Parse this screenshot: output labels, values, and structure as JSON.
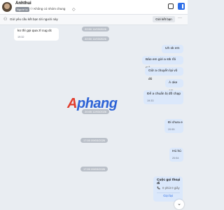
{
  "header": {
    "contact_name": "Anhthui",
    "badge": "Người lạ",
    "group_status": "Không có nhóm chung",
    "tag_icon": "tag-icon",
    "icons": [
      "window-icon",
      "sidebar-toggle-icon"
    ]
  },
  "request_bar": {
    "text": "Gửi yêu cầu kết bạn tới người này",
    "button": "Gửi kết bạn",
    "more": "···"
  },
  "timestamps": {
    "t1": "22:50 11/03/2026",
    "t2": "22:50 11/03/2026",
    "t3": "20:55 12/03/2026",
    "t4": "17:00 09/03/2026"
  },
  "messages": {
    "m1_text": "ko thì gọi qua zl cug dc",
    "m1_time": "19:32",
    "m2_text": "Uh ok em",
    "m3_text": "Bảo em gửi a stk rồi mà",
    "m4_text": "Giờ a chuyển lại vô đó",
    "m5_text": "À oke em",
    "m6_text": "Để a chuẩn bị đồ chạp",
    "m6_time": "19:33",
    "m7_text": "Đi chưa e",
    "m7_time": "20:55",
    "m8_text": "Hú hú",
    "m8_time": "20:54"
  },
  "call": {
    "title": "Cuộc gọi thoại đi",
    "duration": "0 phút 0 giây",
    "action": "Gọi lại"
  },
  "watermark": {
    "first": "A",
    "rest": "phang"
  },
  "scroll_button_icon": "chevron-down-icon"
}
